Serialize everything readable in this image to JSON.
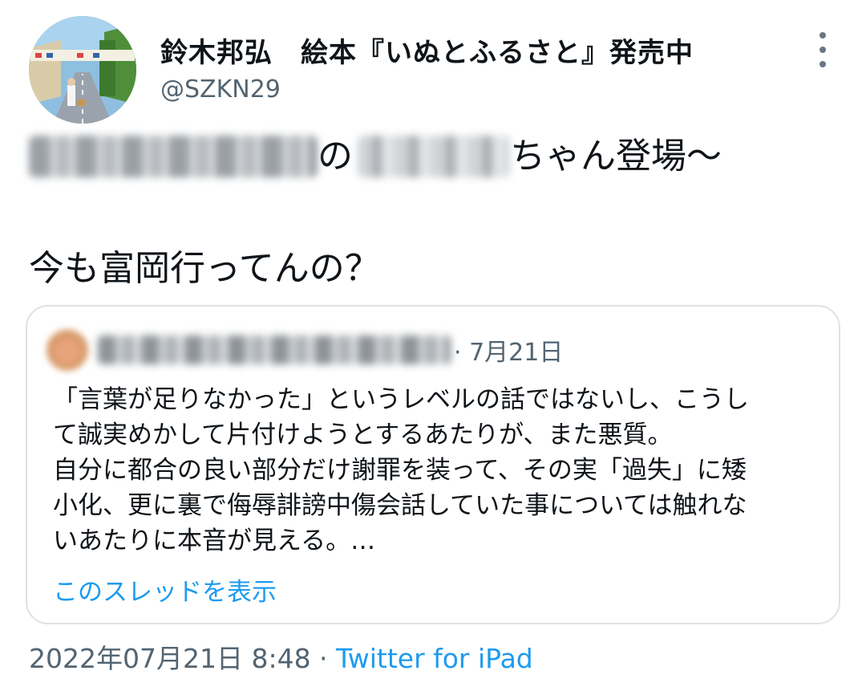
{
  "author": {
    "name": "鈴木邦弘　絵本『いぬとふるさと』発売中",
    "handle": "@SZKN29"
  },
  "tweet": {
    "line1_after_blur1": "の",
    "line1_after_blur2": "ちゃん登場〜",
    "line2": "今も富岡行ってんの？"
  },
  "quote": {
    "meta": "· 7月21日",
    "lines": [
      "「言葉が足りなかった」というレベルの話ではないし、こうし",
      "て誠実めかして片付けようとするあたりが、また悪質。",
      "自分に都合の良い部分だけ謝罪を装って、その実「過失」に矮",
      "小化、更に裏で侮辱誹謗中傷会話していた事については触れな",
      "いあたりに本音が見える。…"
    ],
    "show_thread": "このスレッドを表示"
  },
  "footer": {
    "timestamp": "2022年07月21日 8:48 · ",
    "client": "Twitter for iPad"
  },
  "colors": {
    "link": "#1d9bf0",
    "secondary_text": "#536471",
    "border": "#dde2e6"
  }
}
